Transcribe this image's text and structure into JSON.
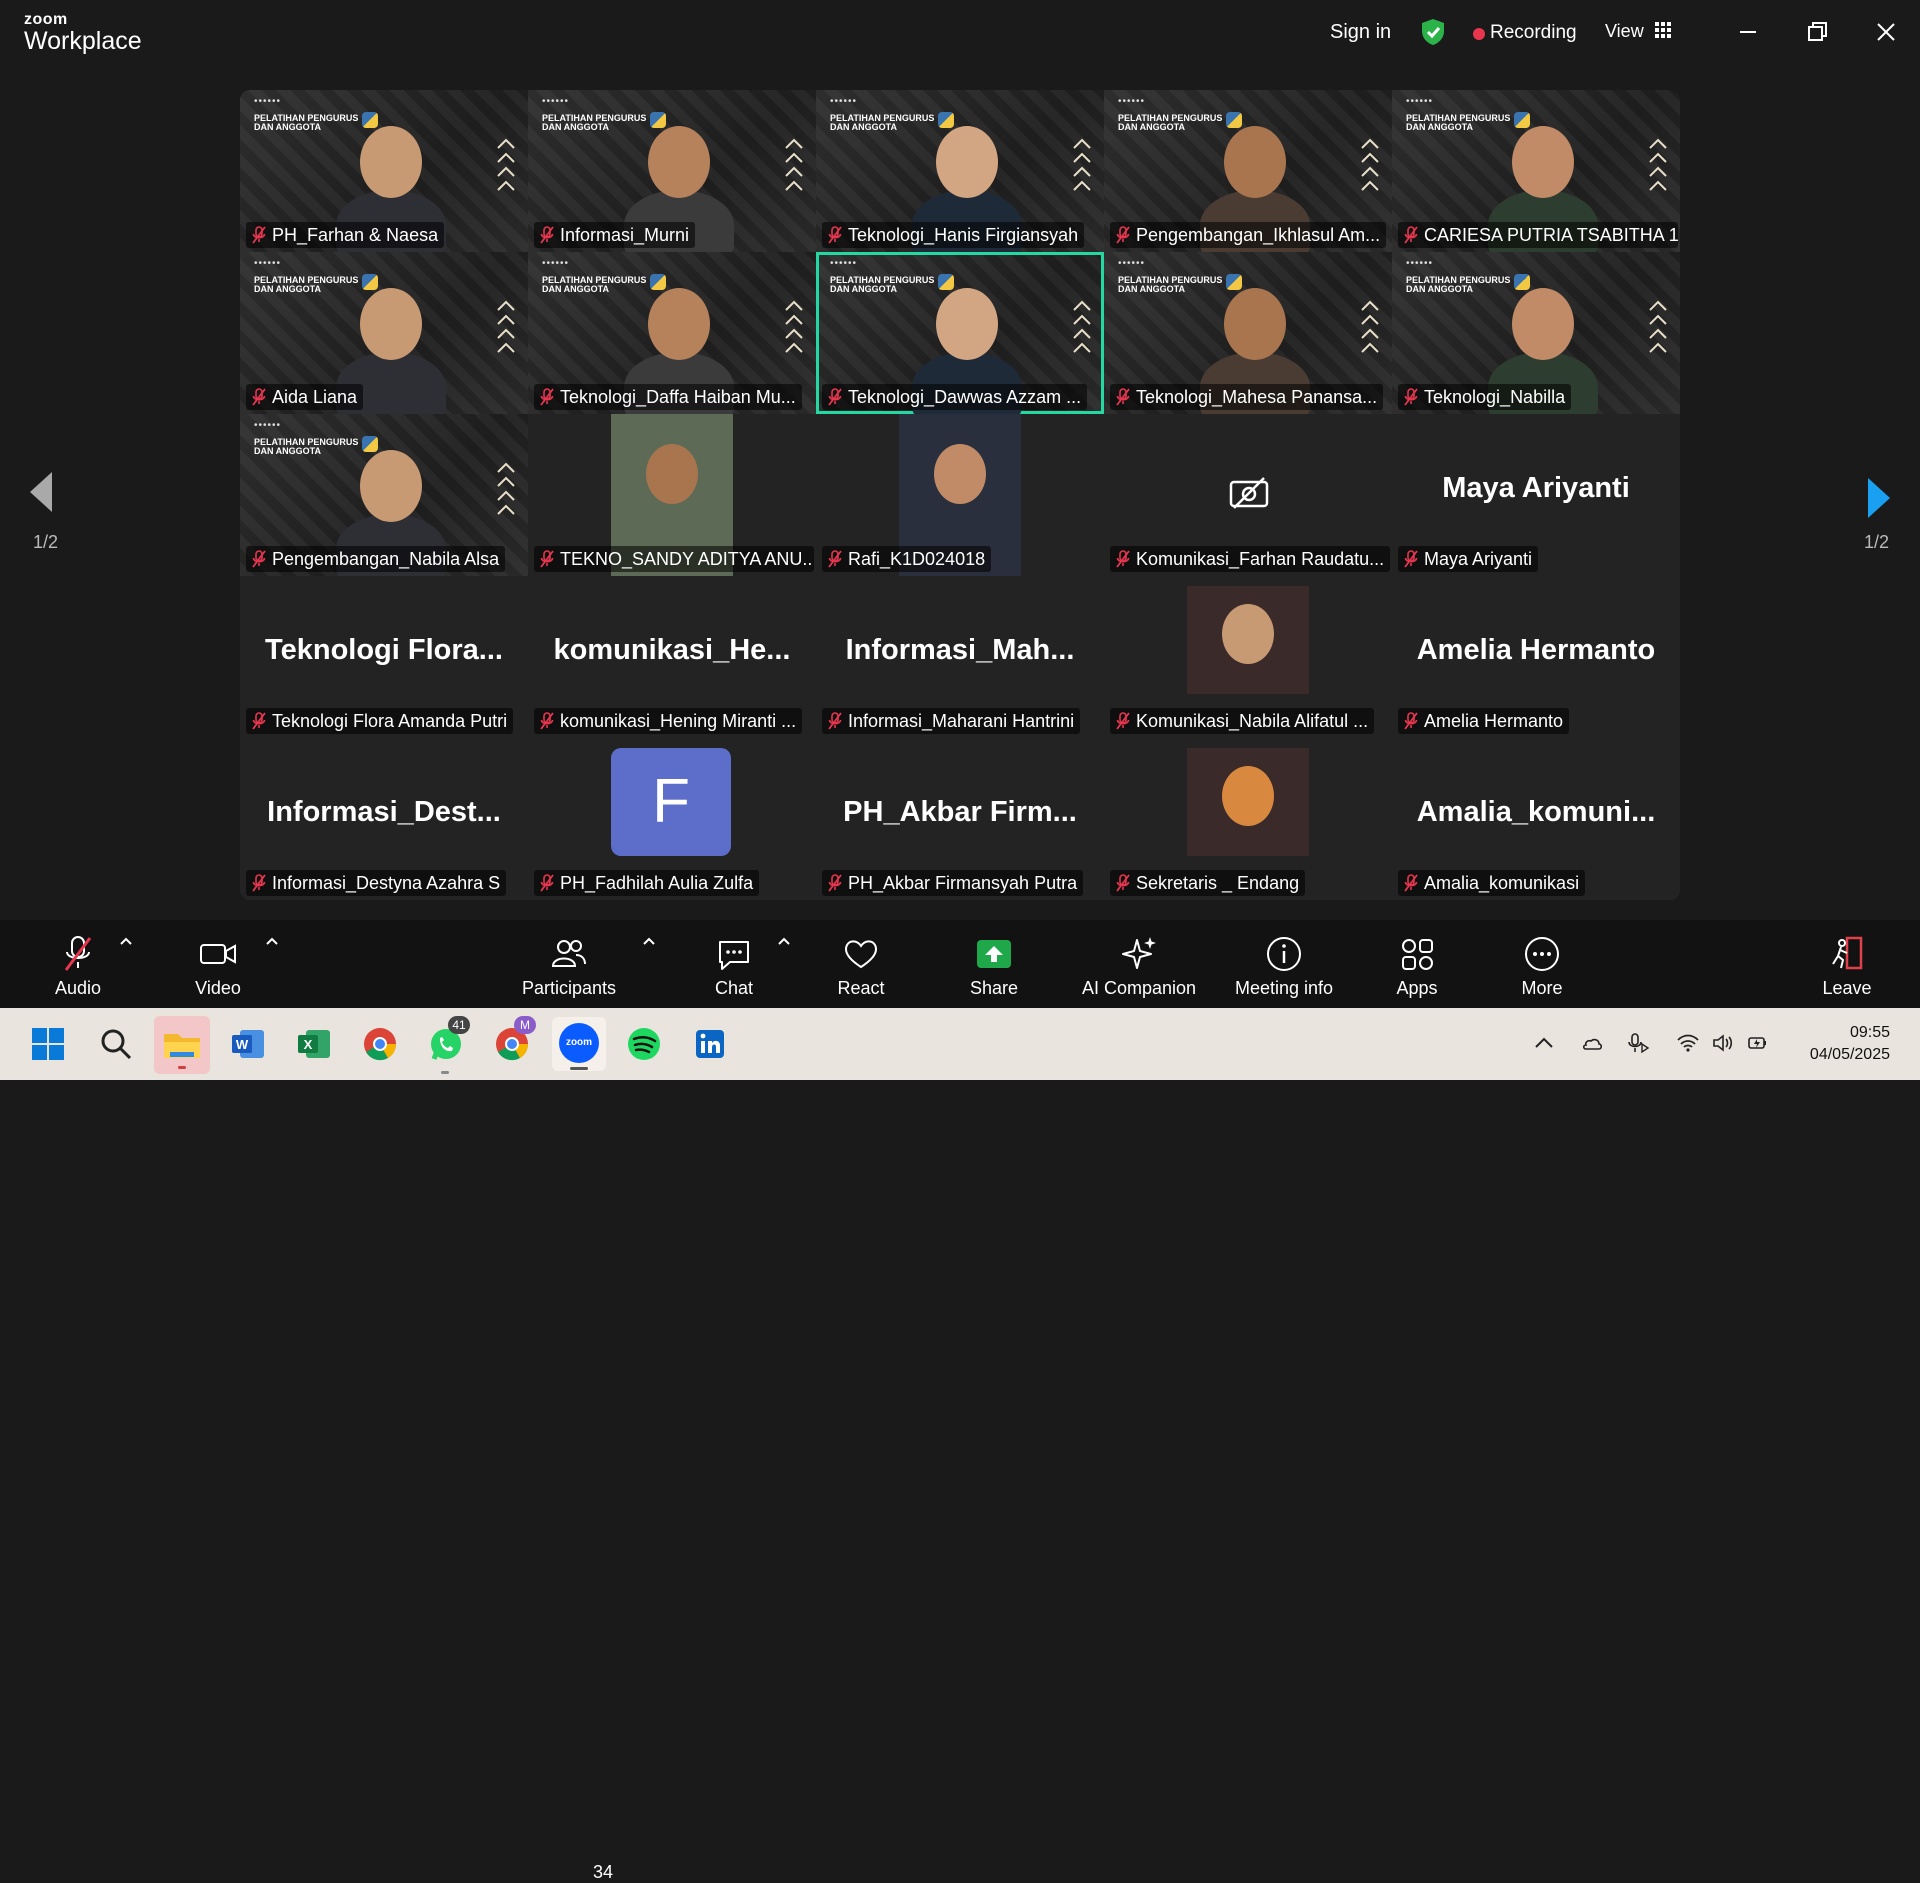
{
  "app": {
    "logo_top": "zoom",
    "logo_bottom": "Workplace",
    "sign_in": "Sign in",
    "recording": "Recording",
    "view": "View"
  },
  "colors": {
    "recording_dot": "#e8364f",
    "shield": "#2bb34a",
    "active_speaker": "#23d9a1",
    "share_button": "#1fa84a",
    "leave_icon": "#e0404a"
  },
  "grid": {
    "brand_line1": "PELATIHAN PENGURUS",
    "brand_line2": "DAN ANGGOTA",
    "tiles": [
      {
        "name": "PH_Farhan & Naesa",
        "kind": "video"
      },
      {
        "name": "Informasi_Murni",
        "kind": "video"
      },
      {
        "name": "Teknologi_Hanis Firgiansyah",
        "kind": "video"
      },
      {
        "name": "Pengembangan_Ikhlasul Am...",
        "kind": "video"
      },
      {
        "name": "CARIESA PUTRIA TSABITHA 1",
        "kind": "video"
      },
      {
        "name": "Aida Liana",
        "kind": "video"
      },
      {
        "name": "Teknologi_Daffa Haiban Mu...",
        "kind": "video"
      },
      {
        "name": "Teknologi_Dawwas Azzam ...",
        "kind": "video",
        "active": true
      },
      {
        "name": "Teknologi_Mahesa Panansa...",
        "kind": "video"
      },
      {
        "name": "Teknologi_Nabilla",
        "kind": "video"
      },
      {
        "name": "Pengembangan_Nabila Alsa",
        "kind": "video"
      },
      {
        "name": "TEKNO_SANDY ADITYA ANU...",
        "kind": "photo"
      },
      {
        "name": "Rafi_K1D024018",
        "kind": "photo"
      },
      {
        "name": "Komunikasi_Farhan Raudatu...",
        "kind": "camera-off"
      },
      {
        "name": "Maya Ariyanti",
        "kind": "text",
        "big": "Maya Ariyanti"
      },
      {
        "name": "Teknologi Flora Amanda Putri",
        "kind": "text",
        "big": "Teknologi  Flora..."
      },
      {
        "name": "komunikasi_Hening Miranti ...",
        "kind": "text",
        "big": "komunikasi_He..."
      },
      {
        "name": "Informasi_Maharani Hantrini",
        "kind": "text",
        "big": "Informasi_Mah..."
      },
      {
        "name": "Komunikasi_Nabila Alifatul ...",
        "kind": "photo"
      },
      {
        "name": "Amelia Hermanto",
        "kind": "text",
        "big": "Amelia Hermanto"
      },
      {
        "name": "Informasi_Destyna Azahra S",
        "kind": "text",
        "big": "Informasi_Dest..."
      },
      {
        "name": "PH_Fadhilah Aulia Zulfa",
        "kind": "letter",
        "letter": "F"
      },
      {
        "name": "PH_Akbar Firmansyah Putra",
        "kind": "text",
        "big": "PH_Akbar  Firm..."
      },
      {
        "name": "Sekretaris _ Endang",
        "kind": "photo"
      },
      {
        "name": "Amalia_komunikasi",
        "kind": "text",
        "big": "Amalia_komuni..."
      }
    ]
  },
  "paging": {
    "left": "1/2",
    "right": "1/2"
  },
  "toolbar": {
    "audio": "Audio",
    "video": "Video",
    "participants": "Participants",
    "participants_count": "34",
    "chat": "Chat",
    "react": "React",
    "share": "Share",
    "ai_companion": "AI Companion",
    "meeting_info": "Meeting info",
    "apps": "Apps",
    "more": "More",
    "leave": "Leave"
  },
  "taskbar": {
    "whatsapp_badge": "41",
    "chrome_profile": "M",
    "zoom_label": "zoom",
    "time": "09:55",
    "date": "04/05/2025"
  }
}
